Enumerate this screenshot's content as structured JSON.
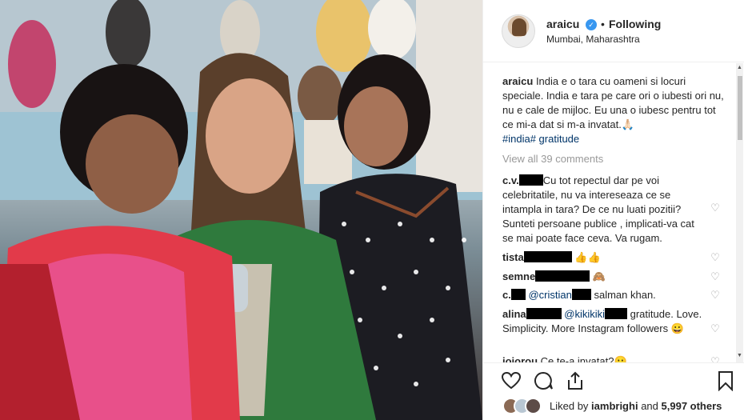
{
  "post": {
    "image_alt": "",
    "author": {
      "username": "araicu",
      "verified": true,
      "separator": "•",
      "follow_status": "Following",
      "location": "Mumbai, Maharashtra"
    },
    "caption": {
      "username": "araicu",
      "text": "India e o tara cu oameni si locuri speciale. India e tara pe care ori o iubesti ori nu, nu e cale de mijloc. Eu una o iubesc pentru tot ce mi-a dat si m-a invatat.🙏🏻",
      "hashtags": "#india# gratitude"
    },
    "view_all_comments": "View all 39 comments",
    "comments": [
      {
        "user": "c.v.",
        "text": "Cu tot repectul dar pe voi celebritatile, nu va intereseaza ce se intampla in tara? De ce nu luati pozitii? Sunteti persoane publice , implicati-va cat se mai poate face ceva. Va rugam."
      },
      {
        "user": "tista",
        "text": "👍👍"
      },
      {
        "user": "semne",
        "text": "🙈"
      },
      {
        "user": "c.",
        "mention": "@cristian",
        "text": "salman khan."
      },
      {
        "user": "alina",
        "mention": "@kikikiki",
        "text": "gratitude. Love. Simplicity. More Instagram followers 😀"
      },
      {
        "user": "ioiorou",
        "text": "Ce te-a invatat?😐"
      }
    ],
    "likes": {
      "prefix": "Liked by",
      "user": "iambrighi",
      "connector": "and",
      "others": "5,997 others"
    }
  },
  "icons": {
    "like": "heart-icon",
    "comment": "comment-icon",
    "share": "share-icon",
    "save": "bookmark-icon",
    "verified": "verified-badge-icon"
  },
  "colors": {
    "verified": "#3897f0",
    "link": "#003569",
    "muted": "#999999",
    "text": "#262626"
  }
}
